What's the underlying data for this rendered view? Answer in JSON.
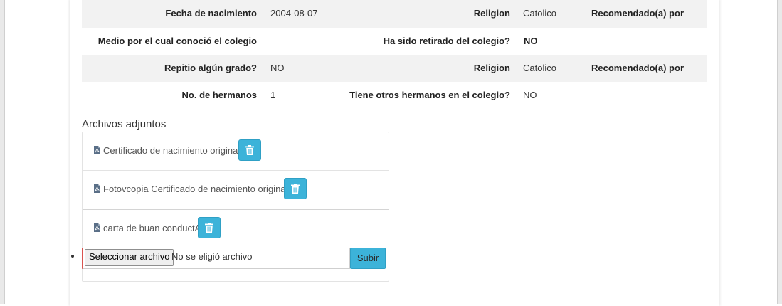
{
  "details": {
    "rows": [
      {
        "label1": "Fecha de nacimiento",
        "value1": "2004-08-07",
        "label2": "Religion",
        "value2": "Catolico",
        "label3": "Recomendado(a) por"
      },
      {
        "label1": "Medio por el cual conoció el colegio",
        "value1": "",
        "label2": "Ha sido retirado del colegio?",
        "value2": "NO"
      },
      {
        "label1": "Repitio algún grado?",
        "value1": "NO",
        "label2": "Religion",
        "value2": "Catolico",
        "label3": "Recomendado(a) por"
      },
      {
        "label1": "No. de hermanos",
        "value1": "1",
        "label2": "Tiene otros hermanos en el colegio?",
        "value2": "NO"
      }
    ]
  },
  "attachments": {
    "title": "Archivos adjuntos",
    "files": [
      {
        "name": "Certificado de nacimiento original",
        "icon": "file-pdf-icon"
      },
      {
        "name": "Fotovcopia Certificado de nacimiento original",
        "icon": "file-pdf-icon"
      },
      {
        "name": "carta de buan conductA",
        "icon": "file-pdf-icon"
      }
    ],
    "delete_icon": "trash-icon",
    "upload": {
      "choose_label": "Seleccionar archivo",
      "no_file_text": "No se eligió archivo",
      "submit_label": "Subir"
    }
  },
  "colors": {
    "accent": "#3cb3d9",
    "row_shade": "#f2f2f2",
    "error_border": "#d9534f"
  }
}
